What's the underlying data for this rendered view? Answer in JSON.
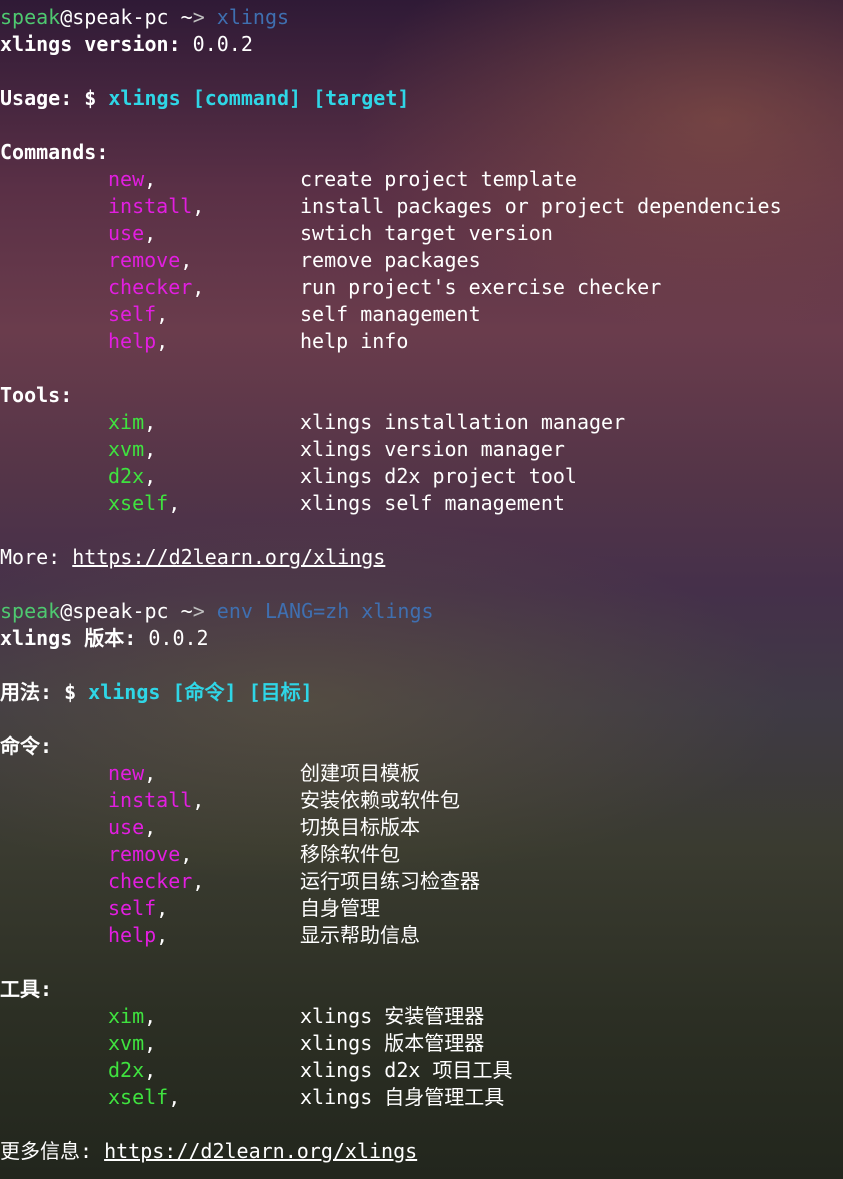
{
  "colors": {
    "prompt_user": "#4ec970",
    "command_text": "#3f6fb0",
    "usage_highlight": "#2fd6e6",
    "command_name": "#e21ee0",
    "tool_name": "#3fe23f"
  },
  "session1": {
    "prompt": {
      "user": "speak",
      "at_host": "@speak-pc",
      "path": " ~",
      "arrow": ">",
      "command": "xlings"
    },
    "version_label": "xlings version:",
    "version_value": " 0.0.2",
    "usage_label": "Usage: $ ",
    "usage_cmd": "xlings [command] [target]",
    "commands_header": "Commands:",
    "commands": [
      {
        "name": "new",
        "sep": ",",
        "desc": "create project template"
      },
      {
        "name": "install",
        "sep": ",",
        "desc": "install packages or project dependencies"
      },
      {
        "name": "use",
        "sep": ",",
        "desc": "swtich target version"
      },
      {
        "name": "remove",
        "sep": ",",
        "desc": "remove packages"
      },
      {
        "name": "checker",
        "sep": ",",
        "desc": "run project's exercise checker"
      },
      {
        "name": "self",
        "sep": ",",
        "desc": "self management"
      },
      {
        "name": "help",
        "sep": ",",
        "desc": "help info"
      }
    ],
    "tools_header": "Tools:",
    "tools": [
      {
        "name": "xim",
        "sep": ",",
        "desc": "xlings installation manager"
      },
      {
        "name": "xvm",
        "sep": ",",
        "desc": "xlings version manager"
      },
      {
        "name": "d2x",
        "sep": ",",
        "desc": "xlings d2x project tool"
      },
      {
        "name": "xself",
        "sep": ",",
        "desc": "xlings self management"
      }
    ],
    "more_label": "More: ",
    "more_url": "https://d2learn.org/xlings"
  },
  "session2": {
    "prompt": {
      "user": "speak",
      "at_host": "@speak-pc",
      "path": " ~",
      "arrow": ">",
      "command": "env LANG=zh xlings"
    },
    "version_label": "xlings 版本:",
    "version_value": " 0.0.2",
    "usage_label": "用法: $ ",
    "usage_cmd": "xlings [命令] [目标]",
    "commands_header": "命令:",
    "commands": [
      {
        "name": "new",
        "sep": ",",
        "desc": "创建项目模板"
      },
      {
        "name": "install",
        "sep": ",",
        "desc": "安装依赖或软件包"
      },
      {
        "name": "use",
        "sep": ",",
        "desc": "切换目标版本"
      },
      {
        "name": "remove",
        "sep": ",",
        "desc": "移除软件包"
      },
      {
        "name": "checker",
        "sep": ",",
        "desc": "运行项目练习检查器"
      },
      {
        "name": "self",
        "sep": ",",
        "desc": "自身管理"
      },
      {
        "name": "help",
        "sep": ",",
        "desc": "显示帮助信息"
      }
    ],
    "tools_header": "工具:",
    "tools": [
      {
        "name": "xim",
        "sep": ",",
        "desc": "xlings 安装管理器"
      },
      {
        "name": "xvm",
        "sep": ",",
        "desc": "xlings 版本管理器"
      },
      {
        "name": "d2x",
        "sep": ",",
        "desc": "xlings d2x 项目工具"
      },
      {
        "name": "xself",
        "sep": ",",
        "desc": "xlings 自身管理工具"
      }
    ],
    "more_label": "更多信息: ",
    "more_url": "https://d2learn.org/xlings"
  }
}
